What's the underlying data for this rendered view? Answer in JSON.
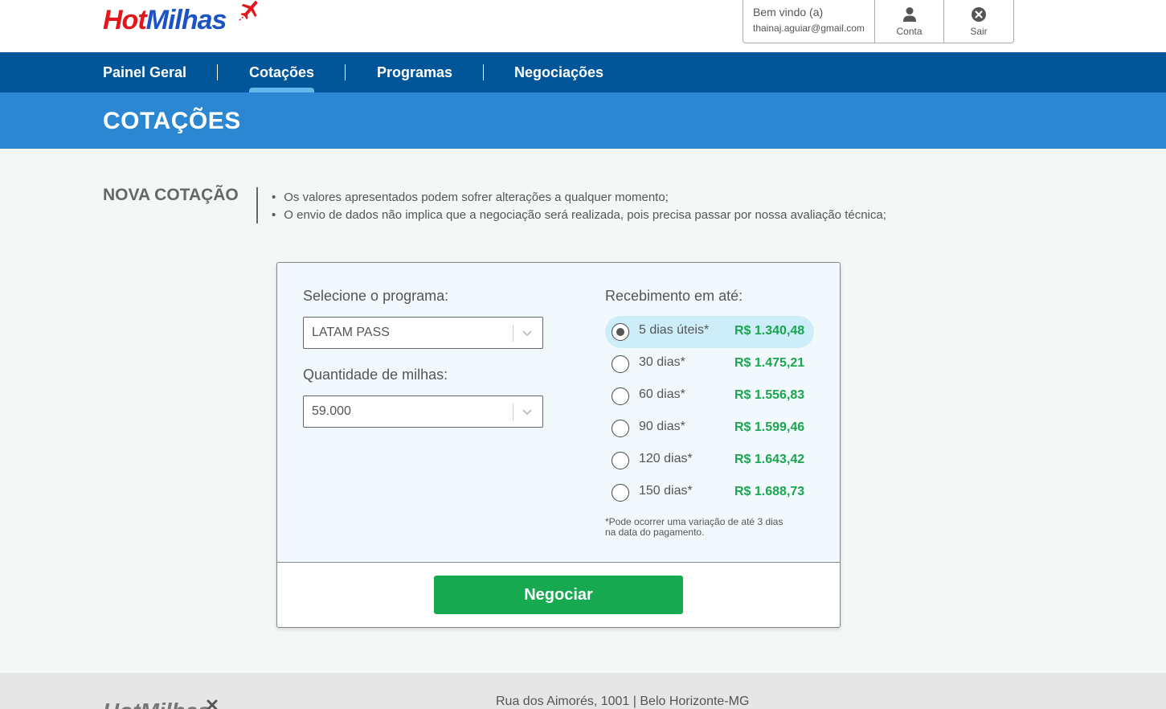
{
  "brand": {
    "logo_part1": "Hot",
    "logo_part2": "Milhas",
    "logo_icon": "plane-icon"
  },
  "user": {
    "welcome": "Bem vindo (a)",
    "email": "thainaj.aguiar@gmail.com",
    "account_label": "Conta",
    "account_icon": "user-icon",
    "logout_label": "Sair",
    "logout_icon": "close-circle-icon"
  },
  "nav": {
    "items": [
      {
        "label": "Painel Geral",
        "active": false
      },
      {
        "label": "Cotações",
        "active": true
      },
      {
        "label": "Programas",
        "active": false
      },
      {
        "label": "Negociações",
        "active": false
      }
    ]
  },
  "page": {
    "title": "COTAÇÕES"
  },
  "intro": {
    "title": "NOVA COTAÇÃO",
    "notes": [
      "Os valores apresentados podem sofrer alterações a qualquer momento;",
      "O envio de dados não implica que a negociação será realizada, pois precisa passar por nossa avaliação técnica;"
    ]
  },
  "form": {
    "program_label": "Selecione o programa:",
    "program_value": "LATAM PASS",
    "miles_label": "Quantidade de milhas:",
    "miles_value": "59.000",
    "receipt_label": "Recebimento em até:",
    "options": [
      {
        "label": "5 dias úteis*",
        "price": "R$ 1.340,48",
        "selected": true
      },
      {
        "label": "30 dias*",
        "price": "R$ 1.475,21",
        "selected": false
      },
      {
        "label": "60 dias*",
        "price": "R$ 1.556,83",
        "selected": false
      },
      {
        "label": "90 dias*",
        "price": "R$ 1.599,46",
        "selected": false
      },
      {
        "label": "120 dias*",
        "price": "R$ 1.643,42",
        "selected": false
      },
      {
        "label": "150 dias*",
        "price": "R$ 1.688,73",
        "selected": false
      }
    ],
    "disclaimer_line1": "*Pode ocorrer uma variação de até 3 dias",
    "disclaimer_line2": "na data do pagamento.",
    "submit_label": "Negociar"
  },
  "footer": {
    "address": "Rua dos Aimorés, 1001 | Belo Horizonte-MG",
    "logo_text": "HotMilhas"
  },
  "colors": {
    "nav_bg": "#01569a",
    "title_band": "#2b87d1",
    "active_indicator": "#5fb8ec",
    "price_green": "#1aa54f",
    "button_green": "#16a94f",
    "logo_red": "#e3161b",
    "logo_blue": "#1c53c4"
  }
}
